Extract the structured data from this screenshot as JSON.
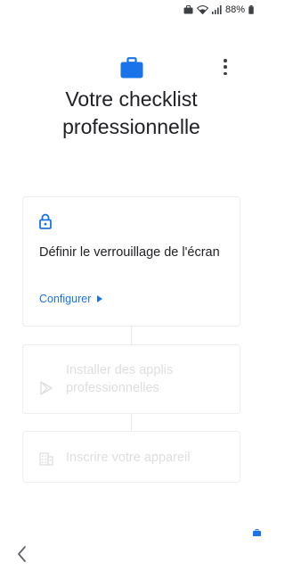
{
  "status_bar": {
    "battery": "88%",
    "icons": [
      "work-profile-icon",
      "wifi-icon",
      "signal-icon",
      "battery-icon"
    ]
  },
  "header": {
    "icon": "briefcase-icon",
    "menu_icon": "more-vert-icon"
  },
  "title": "Votre checklist professionnelle",
  "tasks": [
    {
      "icon": "lock-icon",
      "title": "Définir le verrouillage de l'écran",
      "action": "Configurer",
      "action_icon": "play-arrow-icon",
      "state": "active"
    },
    {
      "icon": "play-store-icon",
      "title": "Installer des applis professionnelles",
      "state": "disabled"
    },
    {
      "icon": "building-icon",
      "title": "Inscrire votre appareil",
      "state": "disabled"
    }
  ],
  "nav": {
    "back_icon": "chevron-left-icon"
  },
  "colors": {
    "accent": "#1a73e8",
    "text": "#202124",
    "disabled_text": "#dedede",
    "card_border": "#eeeeee"
  }
}
